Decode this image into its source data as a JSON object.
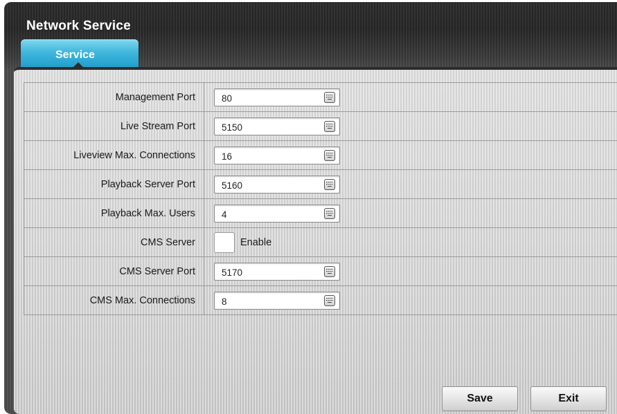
{
  "window": {
    "title": "Network Service"
  },
  "tabs": [
    {
      "label": "Service",
      "active": true
    }
  ],
  "settings": [
    {
      "label": "Management Port",
      "type": "input",
      "value": "80"
    },
    {
      "label": "Live Stream Port",
      "type": "input",
      "value": "5150"
    },
    {
      "label": "Liveview Max. Connections",
      "type": "input",
      "value": "16"
    },
    {
      "label": "Playback Server Port",
      "type": "input",
      "value": "5160"
    },
    {
      "label": "Playback Max. Users",
      "type": "input",
      "value": "4"
    },
    {
      "label": "CMS Server",
      "type": "checkbox",
      "checked": false,
      "checkbox_label": "Enable"
    },
    {
      "label": "CMS Server Port",
      "type": "input",
      "value": "5170"
    },
    {
      "label": "CMS Max. Connections",
      "type": "input",
      "value": "8"
    }
  ],
  "buttons": {
    "save": "Save",
    "exit": "Exit"
  },
  "icons": {
    "input_action": "keyboard-icon"
  },
  "colors": {
    "tab_accent": "#3fb6dc",
    "header_bg": "#262626"
  }
}
